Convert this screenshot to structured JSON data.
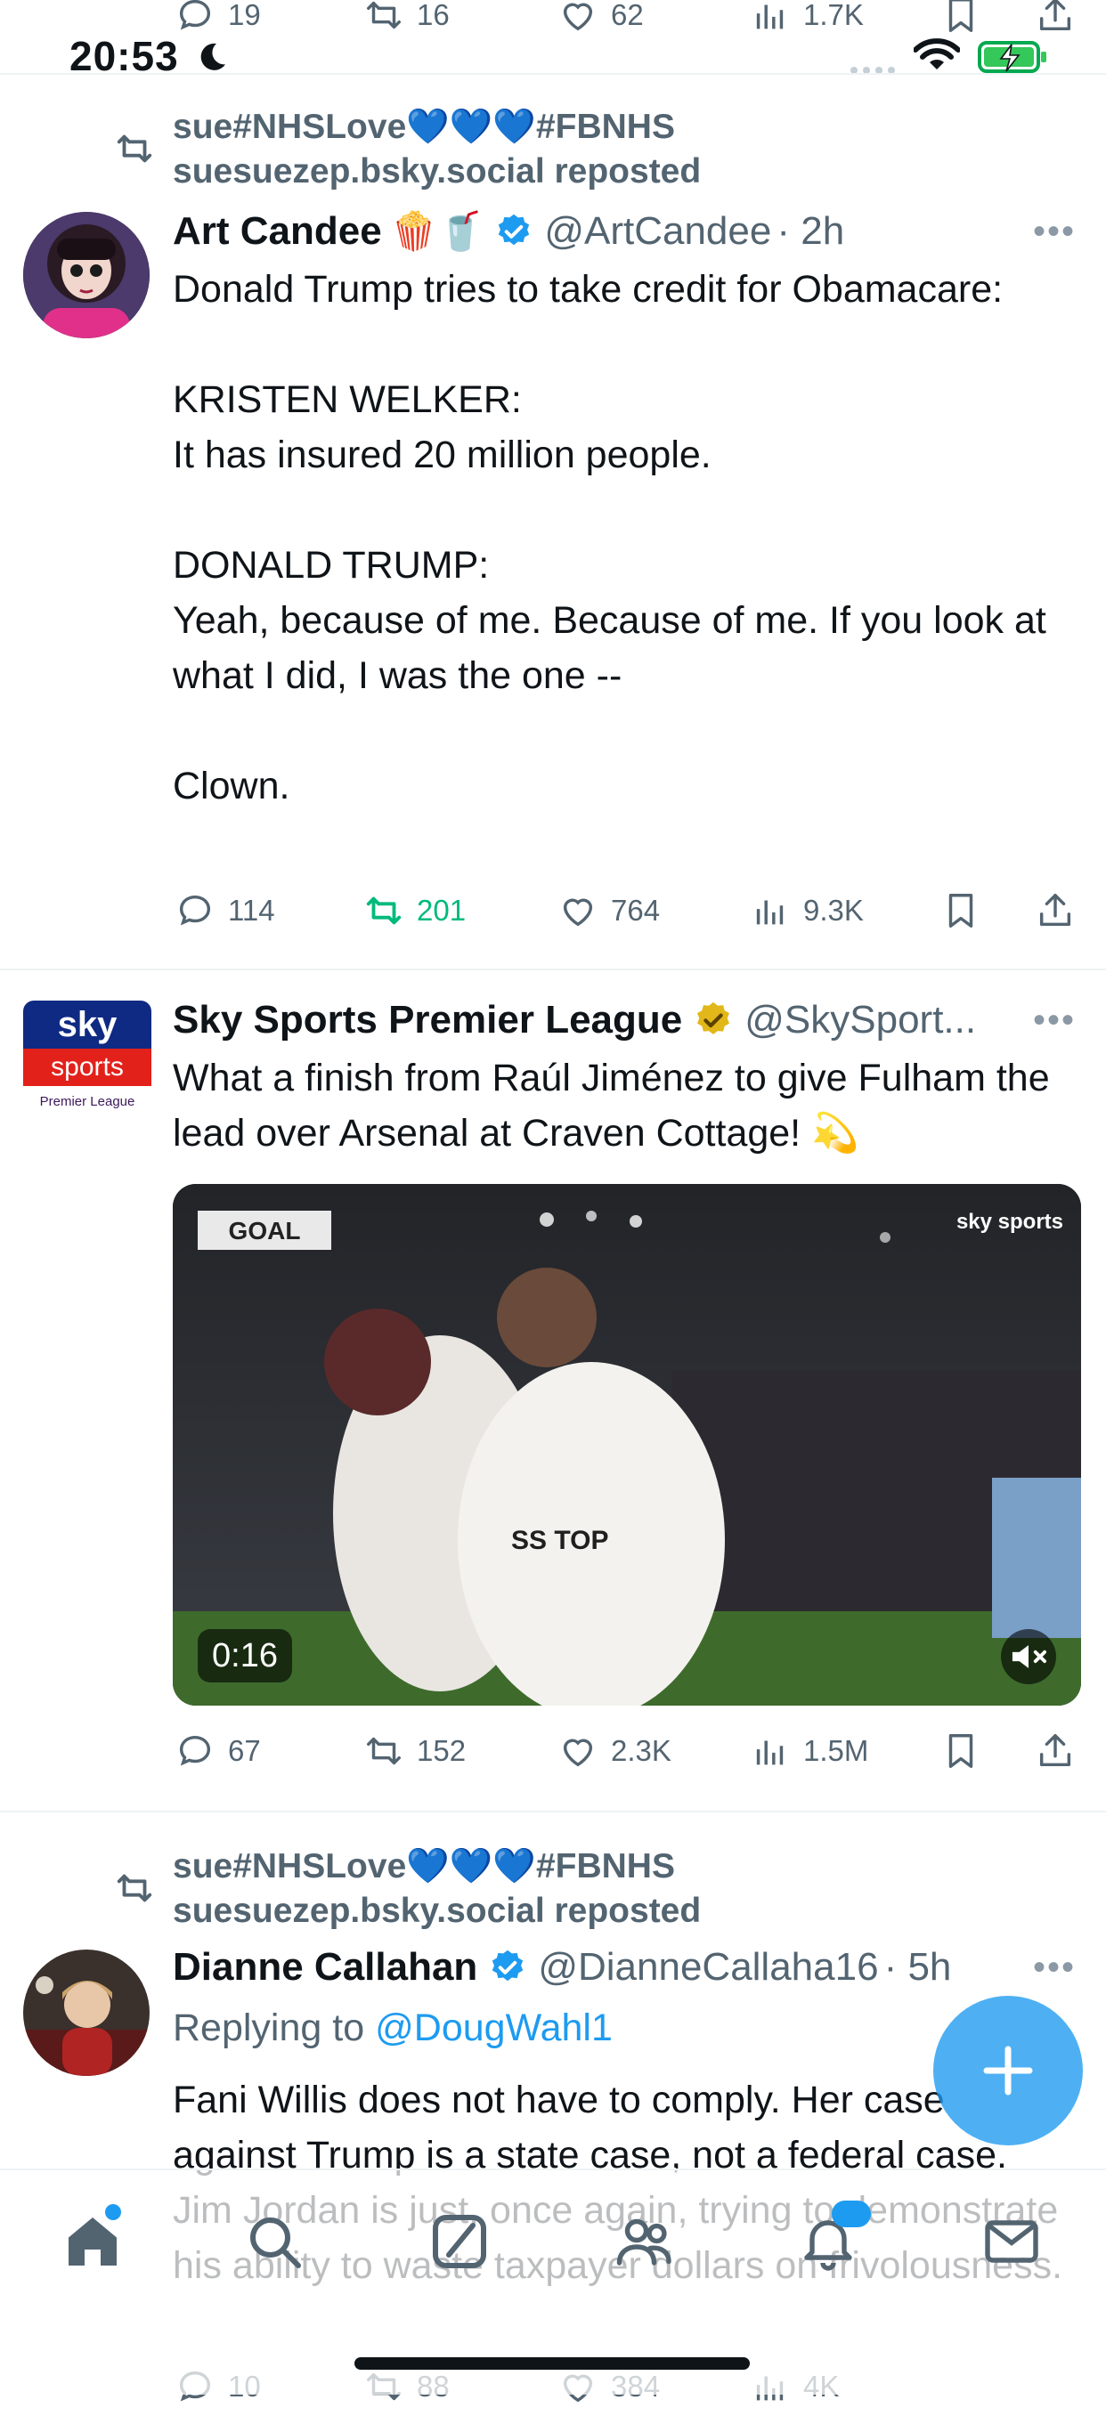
{
  "status_bar": {
    "time": "20:53"
  },
  "top_partial_actions": {
    "replies": "19",
    "reposts": "16",
    "likes": "62",
    "views": "1.7K"
  },
  "posts": [
    {
      "repost_user": "sue#NHSLove💙💙💙#FBNHS",
      "repost_label": "suesuezep.bsky.social reposted",
      "author": "Art Candee",
      "author_emoji": "🍿🥤",
      "handle": "@ArtCandee",
      "time": "· 2h",
      "text": "Donald Trump tries to take credit for Obamacare:\n\nKRISTEN WELKER:\nIt has insured 20 million people.\n\nDONALD TRUMP:\nYeah, because of me. Because of me. If you look at what I did, I was the one --\n\nClown.",
      "replies": "114",
      "reposts": "201",
      "likes": "764",
      "views": "9.3K"
    },
    {
      "author": "Sky Sports Premier League",
      "handle": "@SkySport...",
      "avatar_lines": [
        "sky",
        "sports",
        "Premier League"
      ],
      "text": "What a finish from Raúl Jiménez to give Fulham the lead over Arsenal at Craven Cottage! 💫",
      "video": {
        "badge": "GOAL",
        "brand": "sky sports",
        "duration": "0:16",
        "shirt_text": "SS TOP"
      },
      "replies": "67",
      "reposts": "152",
      "likes": "2.3K",
      "views": "1.5M"
    },
    {
      "repost_user": "sue#NHSLove💙💙💙#FBNHS",
      "repost_label": "suesuezep.bsky.social reposted",
      "author": "Dianne Callahan",
      "handle": "@DianneCallaha16",
      "time": "· 5h",
      "replying_prefix": "Replying to",
      "replying_to": "@DougWahl1",
      "text": "Fani Willis does not have to comply. Her case against Trump is a state case, not a federal case. Jim Jordan is just, once again, trying to demonstrate his ability to waste taxpayer dollars on frivolousness.",
      "replies": "10",
      "reposts": "88",
      "likes": "384",
      "views": "4K"
    }
  ],
  "colors": {
    "accent": "#1d9bf0",
    "repost_green": "#00ba7c",
    "muted": "#536471",
    "verified_gold": "#e2b719"
  },
  "tab_bar": {
    "items": [
      "home-icon",
      "search-icon",
      "grok-icon",
      "communities-icon",
      "notifications-icon",
      "messages-icon"
    ]
  }
}
